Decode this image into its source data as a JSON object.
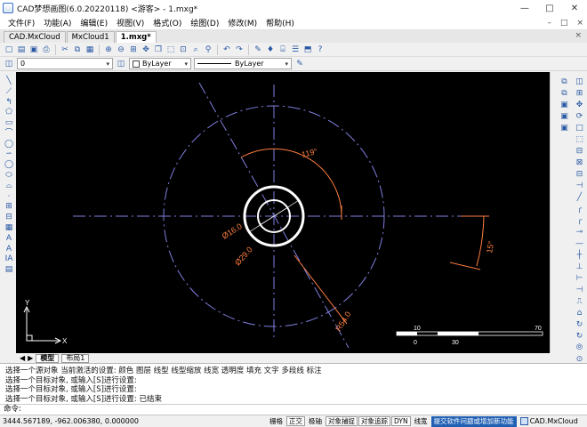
{
  "window": {
    "title": "CAD梦想画图(6.0.20220118) <游客> - 1.mxg*",
    "controls": [
      "—",
      "□",
      "✕"
    ]
  },
  "menu": {
    "items": [
      "文件(F)",
      "功能(A)",
      "编辑(E)",
      "视图(V)",
      "格式(O)",
      "绘图(D)",
      "修改(M)",
      "帮助(H)"
    ],
    "doc_controls": [
      "–",
      "□",
      "×"
    ]
  },
  "tabs": {
    "items": [
      "CAD.MxCloud",
      "MxCloud1",
      "1.mxg*"
    ],
    "active_index": 2,
    "close_glyph": "×"
  },
  "toolbar": {
    "layer_value": "0",
    "color_value": "ByLayer",
    "linetype_value": "ByLayer",
    "combo_arrow": "▾",
    "icons": [
      "new-icon",
      "open-icon",
      "save-icon",
      "print-icon",
      "cut-icon",
      "copy-icon",
      "paste-icon",
      "zoom-in-icon",
      "zoom-out-icon",
      "zoom-window-icon",
      "pan-icon",
      "undo-icon",
      "redo-icon",
      "match-prop-icon",
      "layer-icon"
    ],
    "icon_glyphs": [
      "▢",
      "▤",
      "▣",
      "⎙",
      "✂",
      "⧉",
      "▦",
      "⊕",
      "⊖",
      "⊞",
      "✥",
      "↶",
      "↷",
      "✎",
      "◫",
      "❐",
      "⬚",
      "⊡",
      "⌕",
      "⚲",
      "♦",
      "⌸",
      "☰",
      "⬒",
      "?"
    ]
  },
  "left_tools": {
    "glyphs": [
      "╲",
      "⟋",
      "↰",
      "⬠",
      "▭",
      "⌒",
      "◯",
      "∽",
      "◯",
      "⬭",
      "⌓",
      "·",
      "⊞",
      "⊟",
      "▦",
      "A",
      "A",
      "IA",
      "▤"
    ],
    "names": [
      "line-icon",
      "xline-icon",
      "polyline-icon",
      "polygon-icon",
      "rectangle-icon",
      "arc-icon",
      "circle-icon",
      "revcloud-icon",
      "ellipse-icon",
      "ellipse-arc-icon",
      "spline-icon",
      "point-icon",
      "insert-block-icon",
      "block-icon",
      "hatch-icon",
      "text-icon",
      "mtext-icon",
      "attribute-icon",
      "table-icon"
    ]
  },
  "right_tools": {
    "col1": [
      "⧉",
      "⧉",
      "▣",
      "▣",
      "▣"
    ],
    "col2": [
      "◫",
      "⊞",
      "✥",
      "⟳",
      "□",
      "⬚",
      "⊟",
      "⊠",
      "⊟",
      "⊣",
      "╱",
      "╭",
      "╭",
      "⊸",
      "—",
      "┼",
      "⊥",
      "⊢",
      "⊣",
      "⎍",
      "⌂",
      "↻",
      "↻",
      "⦾",
      "⊙"
    ]
  },
  "drawing": {
    "bg_color": "#000000",
    "circle_color": "#ffffff",
    "center_line_color": "#7f7fe0",
    "dim_color": "#ff7f3f",
    "ucs_color": "#ffffff",
    "labels": {
      "angle_119": "119°",
      "angle_15": "15°",
      "dia_16": "Ø16.0",
      "dia_29": "Ø29.0",
      "radius_54": "R54.0"
    },
    "scale_labels": [
      "0",
      "10",
      "30",
      "70"
    ],
    "ucs_x": "X",
    "ucs_y": "Y"
  },
  "layout_tabs": {
    "items": [
      "模型",
      "布局1"
    ],
    "active_index": 0,
    "nav": [
      "◀",
      "▶"
    ]
  },
  "command": {
    "lines": [
      "选择一个源对象  当前激活的设置: 颜色    图层    线型    线型缩放    线宽    透明度    填充    文字    多段线    标注",
      "选择一个目标对象, 或输入[S]进行设置:",
      "选择一个目标对象, 或输入[S]进行设置:",
      "选择一个目标对象, 或输入[S]进行设置:  已结束"
    ],
    "prompt": "命令:"
  },
  "status": {
    "coords": "3444.567189,  -962.006380,  0.000000",
    "buttons": [
      "栅格",
      "正交",
      "极轴",
      "对象捕捉",
      "对象追踪",
      "DYN",
      "线宽"
    ],
    "promo": "提交软件问题或增加新功能",
    "brand": "CAD.MxCloud"
  }
}
